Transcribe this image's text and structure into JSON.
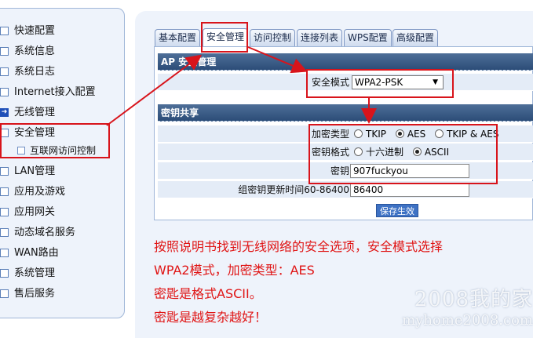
{
  "sidebar": {
    "items": [
      {
        "label": "快速配置"
      },
      {
        "label": "系统信息"
      },
      {
        "label": "系统日志"
      },
      {
        "label": "Internet接入配置"
      },
      {
        "label": "无线管理"
      },
      {
        "label": "安全管理"
      },
      {
        "label": "LAN管理"
      },
      {
        "label": "应用及游戏"
      },
      {
        "label": "应用网关"
      },
      {
        "label": "动态域名服务"
      },
      {
        "label": "WAN路由"
      },
      {
        "label": "系统管理"
      },
      {
        "label": "售后服务"
      }
    ],
    "sub_item": {
      "label": "互联网访问控制"
    }
  },
  "tabs": [
    {
      "label": "基本配置"
    },
    {
      "label": "安全管理"
    },
    {
      "label": "访问控制"
    },
    {
      "label": "连接列表"
    },
    {
      "label": "WPS配置"
    },
    {
      "label": "高级配置"
    }
  ],
  "ap_section": {
    "title": "AP 安全管理",
    "security_mode_label": "安全模式",
    "security_mode_value": "WPA2-PSK"
  },
  "key_section": {
    "title": "密钥共享",
    "encryption_type_label": "加密类型",
    "encryption_options": [
      "TKIP",
      "AES",
      "TKIP & AES"
    ],
    "encryption_selected": "AES",
    "key_format_label": "密钥格式",
    "key_format_options": [
      "十六进制",
      "ASCII"
    ],
    "key_format_selected": "ASCII",
    "key_label": "密钥",
    "key_value": "907fuckyou",
    "rekey_label": "组密钥更新时间60-86400",
    "rekey_value": "86400"
  },
  "save_button": {
    "label": "保存生效"
  },
  "annotation": {
    "lines": [
      "按照说明书找到无线网络的安全选项，安全模式选择",
      "WPA2模式，加密类型：AES",
      "密匙是格式ASCII。",
      "密匙是越复杂越好！"
    ],
    "color": "#e01515"
  },
  "watermark": {
    "line1": "2008我的家",
    "line2": "myhome2008.com"
  },
  "colors": {
    "section_header": "#3a5b85",
    "row_bg": "#e4ecf7",
    "panel_bg": "#eef3fb",
    "annotation_red": "#d8141b",
    "save_button": "#3e72c4"
  }
}
